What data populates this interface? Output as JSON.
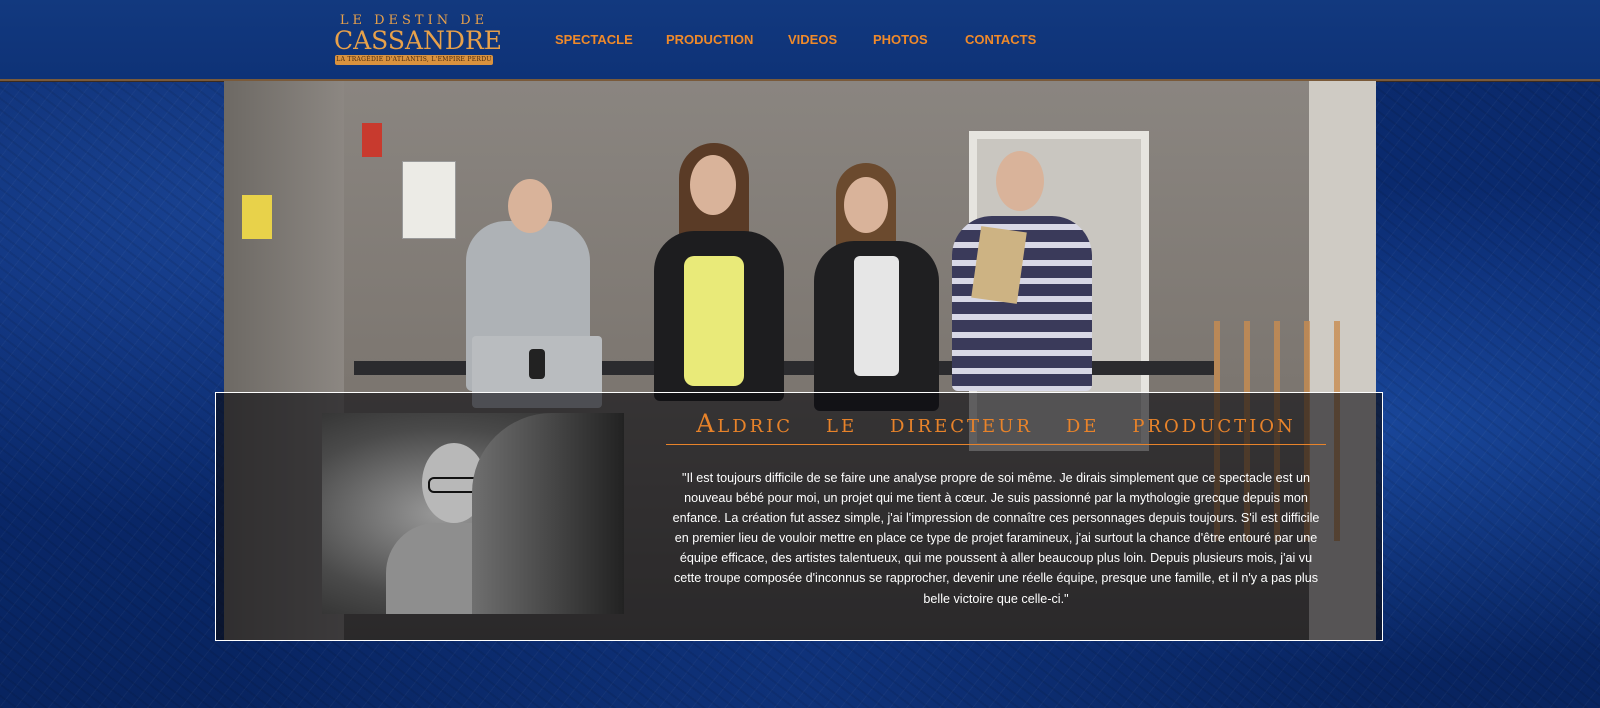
{
  "header": {
    "logo": {
      "line1": "LE DESTIN DE",
      "line2": "CASSANDRE",
      "tagline": "LA TRAGÉDIE D'ATLANTIS, L'EMPIRE PERDU"
    },
    "nav": [
      "SPECTACLE",
      "PRODUCTION",
      "VIDEOS",
      "PHOTOS",
      "CONTACTS"
    ]
  },
  "profile": {
    "title": "Aldric le directeur de production",
    "quote": "\"Il est toujours difficile de se faire une analyse propre de soi même. Je dirais simplement que ce spectacle est un nouveau bébé pour moi, un projet qui me tient à cœur. Je suis passionné par la mythologie grecque depuis mon enfance. La création fut assez simple, j'ai l'impression de connaître ces personnages depuis toujours. S'il est difficile en premier lieu de vouloir mettre en place ce type de projet faramineux, j'ai surtout la chance d'être entouré par une équipe efficace, des artistes talentueux, qui me poussent à aller beaucoup plus loin. Depuis plusieurs mois, j'ai vu cette troupe composée d'inconnus se rapprocher, devenir une réelle équipe, presque une famille, et il n'y a pas plus belle victoire que celle-ci.\""
  },
  "colors": {
    "accent": "#e8832a",
    "nav": "#f08a2a",
    "background": "#0a2a70"
  }
}
